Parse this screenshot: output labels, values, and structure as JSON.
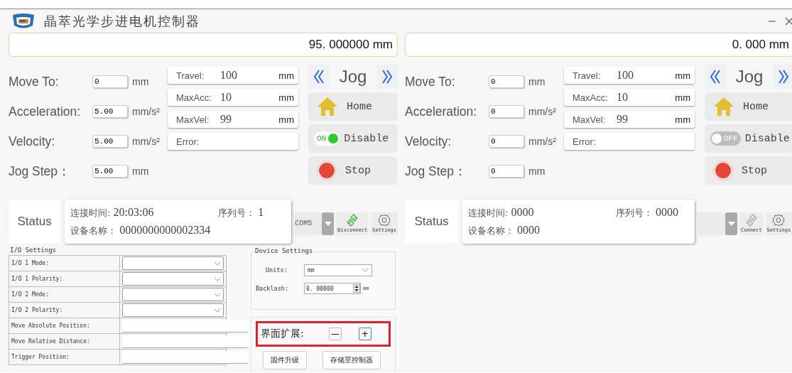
{
  "window": {
    "title": "晶萃光学步进电机控制器"
  },
  "axes": [
    {
      "position": "95. 000000 mm",
      "fields": [
        {
          "label": "Move To:",
          "value": "0",
          "unit": "mm"
        },
        {
          "label": "Acceleration:",
          "value": "5.00",
          "unit": "mm/s²"
        },
        {
          "label": "Velocity:",
          "value": "5.00",
          "unit": "mm/s²"
        },
        {
          "label": "Jog Step：",
          "value": "5.00",
          "unit": "mm"
        }
      ],
      "params": [
        {
          "label": "Travel:",
          "value": "100",
          "unit": "mm"
        },
        {
          "label": "MaxAcc:",
          "value": "10",
          "unit": "mm"
        },
        {
          "label": "MaxVel:",
          "value": "99",
          "unit": "mm"
        },
        {
          "label": "Error:"
        }
      ],
      "jog": "Jog",
      "home": "Home",
      "enable": {
        "on": true,
        "state_label": "ON",
        "label": "Disable"
      },
      "stop": "Stop",
      "status": {
        "title": "Status",
        "time_label": "连接时间:",
        "time": "20:03:06",
        "serial_label": "序列号：",
        "serial": "1",
        "device_label": "设备名称：",
        "device": "0000000000002334"
      },
      "port": "COM5",
      "connected": true,
      "connect_label": "Disconnect",
      "settings_label": "Settings"
    },
    {
      "position": "0. 000 mm",
      "fields": [
        {
          "label": "Move To:",
          "value": "0",
          "unit": "mm"
        },
        {
          "label": "Acceleration:",
          "value": "0",
          "unit": "mm/s²"
        },
        {
          "label": "Velocity:",
          "value": "0",
          "unit": "mm/s²"
        },
        {
          "label": "Jog Step：",
          "value": "0",
          "unit": "mm"
        }
      ],
      "params": [
        {
          "label": "Travel:",
          "value": "100",
          "unit": "mm"
        },
        {
          "label": "MaxAcc:",
          "value": "10",
          "unit": "mm"
        },
        {
          "label": "MaxVel:",
          "value": "99",
          "unit": "mm"
        },
        {
          "label": "Error:"
        }
      ],
      "jog": "Jog",
      "home": "Home",
      "enable": {
        "on": false,
        "state_label": "OFF",
        "label": "Disable"
      },
      "stop": "Stop",
      "status": {
        "title": "Status",
        "time_label": "连接时间:",
        "time": "0000",
        "serial_label": "序列号：",
        "serial": "0000",
        "device_label": "设备名称：",
        "device": "0000"
      },
      "connected": false,
      "connect_label": "Connect",
      "settings_label": "Settings"
    }
  ],
  "io_settings": {
    "title": "I/O Settings",
    "rows": [
      {
        "label": "I/O 1 Mode:",
        "kind": "select"
      },
      {
        "label": "I/O 1 Polarity:",
        "kind": "select"
      },
      {
        "label": "I/O 2 Mode:",
        "kind": "select"
      },
      {
        "label": "I/O 2 Polarity:",
        "kind": "select"
      },
      {
        "label": "Move Absolute Position:",
        "kind": "text"
      },
      {
        "label": "Move Relative Distance:",
        "kind": "text"
      },
      {
        "label": "Trigger Position:",
        "kind": "text"
      }
    ]
  },
  "device_settings": {
    "title": "Device Settings",
    "units_label": "Units:",
    "units": "mm",
    "backlash_label": "Backlash:",
    "backlash": "0. 00000",
    "backlash_unit": "mm"
  },
  "expand": {
    "label": "界面扩展:",
    "minus": "—",
    "plus": "+",
    "highlighted": true
  },
  "buttons": [
    "固件升级",
    "存储至控制器"
  ]
}
